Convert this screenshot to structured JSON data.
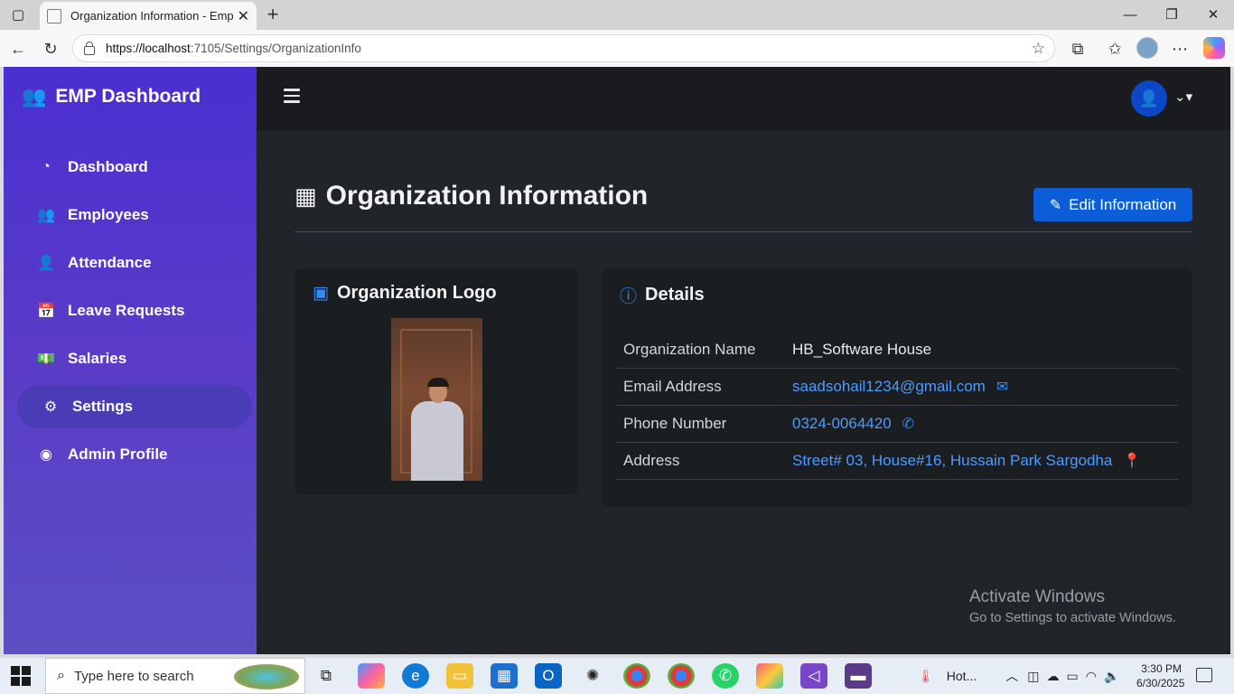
{
  "browser": {
    "tab_title": "Organization Information - Emplo",
    "url_host": "https://localhost",
    "url_rest": ":7105/Settings/OrganizationInfo"
  },
  "brand": {
    "title": "EMP Dashboard",
    "icon": "users-gear-icon"
  },
  "sidebar": {
    "items": [
      {
        "label": "Dashboard",
        "icon": "gauge-icon",
        "active": false
      },
      {
        "label": "Employees",
        "icon": "users-icon",
        "active": false
      },
      {
        "label": "Attendance",
        "icon": "user-check-icon",
        "active": false
      },
      {
        "label": "Leave Requests",
        "icon": "calendar-check-icon",
        "active": false
      },
      {
        "label": "Salaries",
        "icon": "money-bill-icon",
        "active": false
      },
      {
        "label": "Settings",
        "icon": "gear-icon",
        "active": true
      },
      {
        "label": "Admin Profile",
        "icon": "user-circle-icon",
        "active": false
      }
    ]
  },
  "page": {
    "title": "Organization Information",
    "edit_button": "Edit Information"
  },
  "logo_card": {
    "title": "Organization Logo"
  },
  "details_card": {
    "title": "Details",
    "rows": [
      {
        "key": "Organization Name",
        "value": "HB_Software House"
      },
      {
        "key": "Email Address",
        "value": "saadsohail1234@gmail.com"
      },
      {
        "key": "Phone Number",
        "value": "0324-0064420"
      },
      {
        "key": "Address",
        "value": "Street# 03, House#16, Hussain Park Sargodha"
      }
    ]
  },
  "watermark": {
    "line1": "Activate Windows",
    "line2": "Go to Settings to activate Windows."
  },
  "taskbar": {
    "search_placeholder": "Type here to search",
    "tray_label": "Hot...",
    "time": "3:30 PM",
    "date": "6/30/2025"
  },
  "colors": {
    "sidebar_top": "#4a2fd0",
    "main_bg": "#212529",
    "accent": "#0b5ed7",
    "link": "#4e9bff"
  }
}
